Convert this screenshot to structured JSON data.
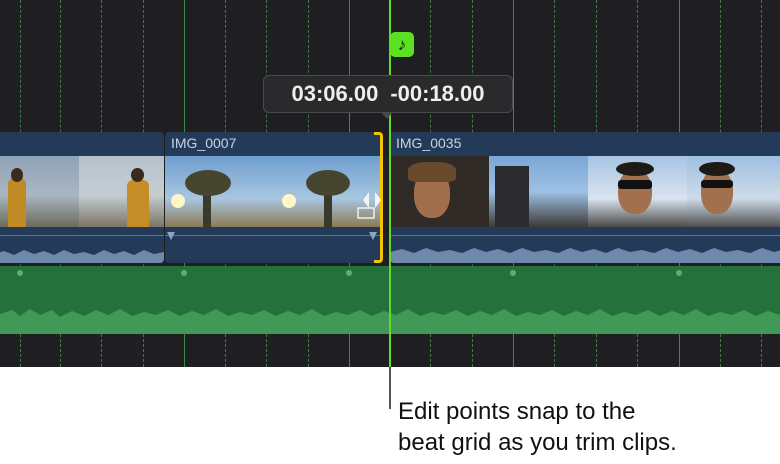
{
  "timeline": {
    "playhead_readout": {
      "position": "03:06.00",
      "delta": "-00:18.00"
    },
    "snap_icon": "music-note-icon",
    "beat_grid_color": "#3d8a45",
    "playhead_color": "#62dc2a",
    "trim_color": "#f5c400",
    "clips": [
      {
        "title": ""
      },
      {
        "title": "IMG_0007"
      },
      {
        "title": "IMG_0035"
      }
    ],
    "music_track_color": "#24713b"
  },
  "callout": {
    "line1": "Edit points snap to the",
    "line2": "beat grid as you trim clips."
  }
}
